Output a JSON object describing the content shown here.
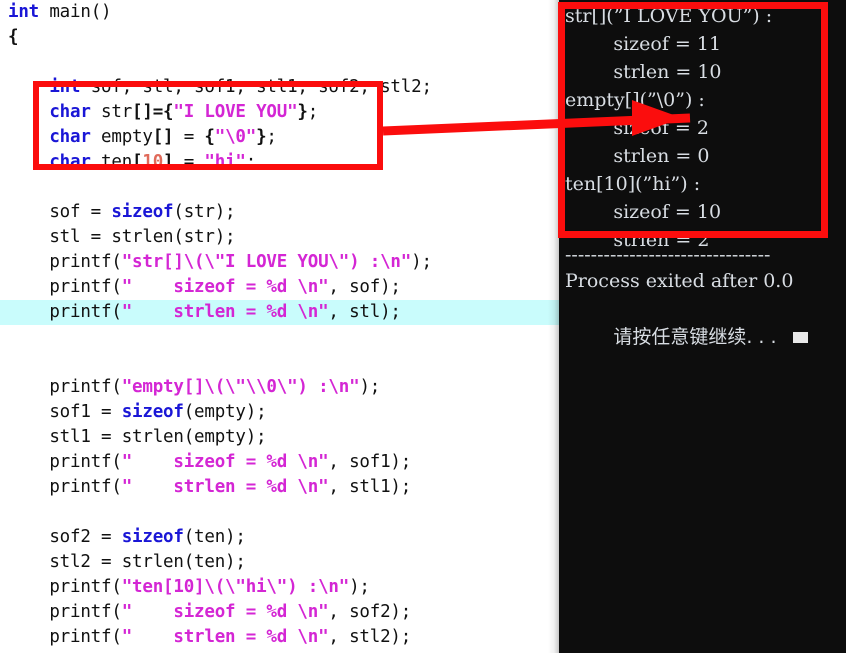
{
  "editor": {
    "name": "c-source-editor",
    "highlighted_line_index": 12,
    "lines": [
      [
        {
          "t": "int",
          "c": "kw"
        },
        {
          "t": " main()",
          "c": "plain"
        }
      ],
      [
        {
          "t": "{",
          "c": "punc"
        }
      ],
      [
        {
          "t": "    ",
          "c": "plain"
        }
      ],
      [
        {
          "t": "    ",
          "c": "plain"
        },
        {
          "t": "int",
          "c": "kw"
        },
        {
          "t": " sof, stl, sof1, stl1, sof2, stl2;",
          "c": "plain"
        }
      ],
      [
        {
          "t": "    ",
          "c": "plain"
        },
        {
          "t": "char",
          "c": "kw"
        },
        {
          "t": " str",
          "c": "plain"
        },
        {
          "t": "[]",
          "c": "punc"
        },
        {
          "t": "=",
          "c": "punc"
        },
        {
          "t": "{",
          "c": "punc"
        },
        {
          "t": "\"I LOVE YOU\"",
          "c": "str"
        },
        {
          "t": "}",
          "c": "punc"
        },
        {
          "t": ";",
          "c": "plain"
        }
      ],
      [
        {
          "t": "    ",
          "c": "plain"
        },
        {
          "t": "char",
          "c": "kw"
        },
        {
          "t": " empty",
          "c": "plain"
        },
        {
          "t": "[]",
          "c": "punc"
        },
        {
          "t": " = ",
          "c": "plain"
        },
        {
          "t": "{",
          "c": "punc"
        },
        {
          "t": "\"\\0\"",
          "c": "str"
        },
        {
          "t": "}",
          "c": "punc"
        },
        {
          "t": ";",
          "c": "plain"
        }
      ],
      [
        {
          "t": "    ",
          "c": "plain"
        },
        {
          "t": "char",
          "c": "kw"
        },
        {
          "t": " ten",
          "c": "plain"
        },
        {
          "t": "[",
          "c": "punc"
        },
        {
          "t": "10",
          "c": "num"
        },
        {
          "t": "]",
          "c": "punc"
        },
        {
          "t": " = ",
          "c": "plain"
        },
        {
          "t": "\"hi\"",
          "c": "str"
        },
        {
          "t": ";",
          "c": "plain"
        }
      ],
      [
        {
          "t": "    ",
          "c": "plain"
        }
      ],
      [
        {
          "t": "    sof = ",
          "c": "plain"
        },
        {
          "t": "sizeof",
          "c": "kw"
        },
        {
          "t": "(str);",
          "c": "plain"
        }
      ],
      [
        {
          "t": "    stl = strlen(str);",
          "c": "plain"
        }
      ],
      [
        {
          "t": "    printf(",
          "c": "plain"
        },
        {
          "t": "\"str[]\\(\\\"I LOVE YOU\\\") :\\n\"",
          "c": "str"
        },
        {
          "t": ");",
          "c": "plain"
        }
      ],
      [
        {
          "t": "    printf(",
          "c": "plain"
        },
        {
          "t": "\"    sizeof = %d \\n\"",
          "c": "str"
        },
        {
          "t": ", sof);",
          "c": "plain"
        }
      ],
      [
        {
          "t": "    printf(",
          "c": "plain"
        },
        {
          "t": "\"    strlen = %d \\n\"",
          "c": "str"
        },
        {
          "t": ", stl);",
          "c": "plain"
        }
      ],
      [
        {
          "t": "",
          "c": "plain"
        }
      ],
      [
        {
          "t": "    ",
          "c": "plain"
        }
      ],
      [
        {
          "t": "    printf(",
          "c": "plain"
        },
        {
          "t": "\"empty[]\\(\\\"\\\\0\\\") :\\n\"",
          "c": "str"
        },
        {
          "t": ");",
          "c": "plain"
        }
      ],
      [
        {
          "t": "    sof1 = ",
          "c": "plain"
        },
        {
          "t": "sizeof",
          "c": "kw"
        },
        {
          "t": "(empty);",
          "c": "plain"
        }
      ],
      [
        {
          "t": "    stl1 = strlen(empty);",
          "c": "plain"
        }
      ],
      [
        {
          "t": "    printf(",
          "c": "plain"
        },
        {
          "t": "\"    sizeof = %d \\n\"",
          "c": "str"
        },
        {
          "t": ", sof1);",
          "c": "plain"
        }
      ],
      [
        {
          "t": "    printf(",
          "c": "plain"
        },
        {
          "t": "\"    strlen = %d \\n\"",
          "c": "str"
        },
        {
          "t": ", stl1);",
          "c": "plain"
        }
      ],
      [
        {
          "t": "    ",
          "c": "plain"
        }
      ],
      [
        {
          "t": "    sof2 = ",
          "c": "plain"
        },
        {
          "t": "sizeof",
          "c": "kw"
        },
        {
          "t": "(ten);",
          "c": "plain"
        }
      ],
      [
        {
          "t": "    stl2 = strlen(ten);",
          "c": "plain"
        }
      ],
      [
        {
          "t": "    printf(",
          "c": "plain"
        },
        {
          "t": "\"ten[10]\\(\\\"hi\\\") :\\n\"",
          "c": "str"
        },
        {
          "t": ");",
          "c": "plain"
        }
      ],
      [
        {
          "t": "    printf(",
          "c": "plain"
        },
        {
          "t": "\"    sizeof = %d \\n\"",
          "c": "str"
        },
        {
          "t": ", sof2);",
          "c": "plain"
        }
      ],
      [
        {
          "t": "    printf(",
          "c": "plain"
        },
        {
          "t": "\"    strlen = %d \\n\"",
          "c": "str"
        },
        {
          "t": ", stl2);",
          "c": "plain"
        }
      ]
    ]
  },
  "console": {
    "name": "program-output-console",
    "output_lines": [
      "str[](”I LOVE YOU”) :",
      "        sizeof = 11",
      "        strlen = 10",
      "empty[](”\\0”) :",
      "        sizeof = 2",
      "        strlen = 0",
      "ten[10](”hi”) :",
      "        sizeof = 10",
      "        strlen = 2"
    ],
    "separator": "--------------------------------",
    "exit_message": "Process exited after 0.0",
    "press_key_message": "请按任意键继续. . . "
  },
  "annotations": {
    "code_box": {
      "name": "red-highlight-box-declarations"
    },
    "console_box": {
      "name": "red-highlight-box-output"
    },
    "arrow": {
      "name": "red-arrow-code-to-output",
      "color": "#fb0d0d"
    }
  },
  "colors": {
    "keyword": "#1a16d6",
    "string": "#d426d4",
    "number": "#e06a5a",
    "annotation_red": "#fb0d0d",
    "highlight_line": "#c9fcfc",
    "console_bg": "#0d0d0d",
    "console_fg": "#d8dde3"
  }
}
